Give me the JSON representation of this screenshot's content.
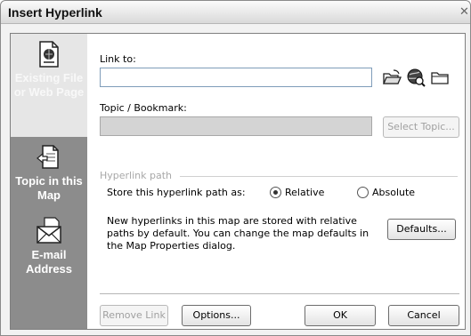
{
  "window": {
    "title": "Insert Hyperlink",
    "close_glyph": "✕"
  },
  "sidebar": {
    "items": [
      {
        "label": "Existing File or Web Page",
        "icon": "document-globe-icon",
        "selected": true
      },
      {
        "label": "Topic in this Map",
        "icon": "topic-map-icon",
        "selected": false
      },
      {
        "label": "E-mail Address",
        "icon": "email-envelope-icon",
        "selected": false
      }
    ]
  },
  "form": {
    "link_to_label": "Link to:",
    "link_to_value": "",
    "topic_label": "Topic / Bookmark:",
    "topic_value": "",
    "select_topic_label": "Select Topic...",
    "browse_icons": [
      "open-folder-icon",
      "browse-web-icon",
      "new-folder-icon"
    ]
  },
  "hyperlink_path": {
    "group_label": "Hyperlink path",
    "store_label": "Store this hyperlink path as:",
    "options": [
      {
        "label": "Relative",
        "checked": true
      },
      {
        "label": "Absolute",
        "checked": false
      }
    ],
    "description": "New hyperlinks in this map are stored with relative paths by default. You can change the map defaults in the Map Properties dialog.",
    "defaults_label": "Defaults..."
  },
  "footer": {
    "remove_link_label": "Remove Link",
    "options_label": "Options...",
    "ok_label": "OK",
    "cancel_label": "Cancel"
  }
}
